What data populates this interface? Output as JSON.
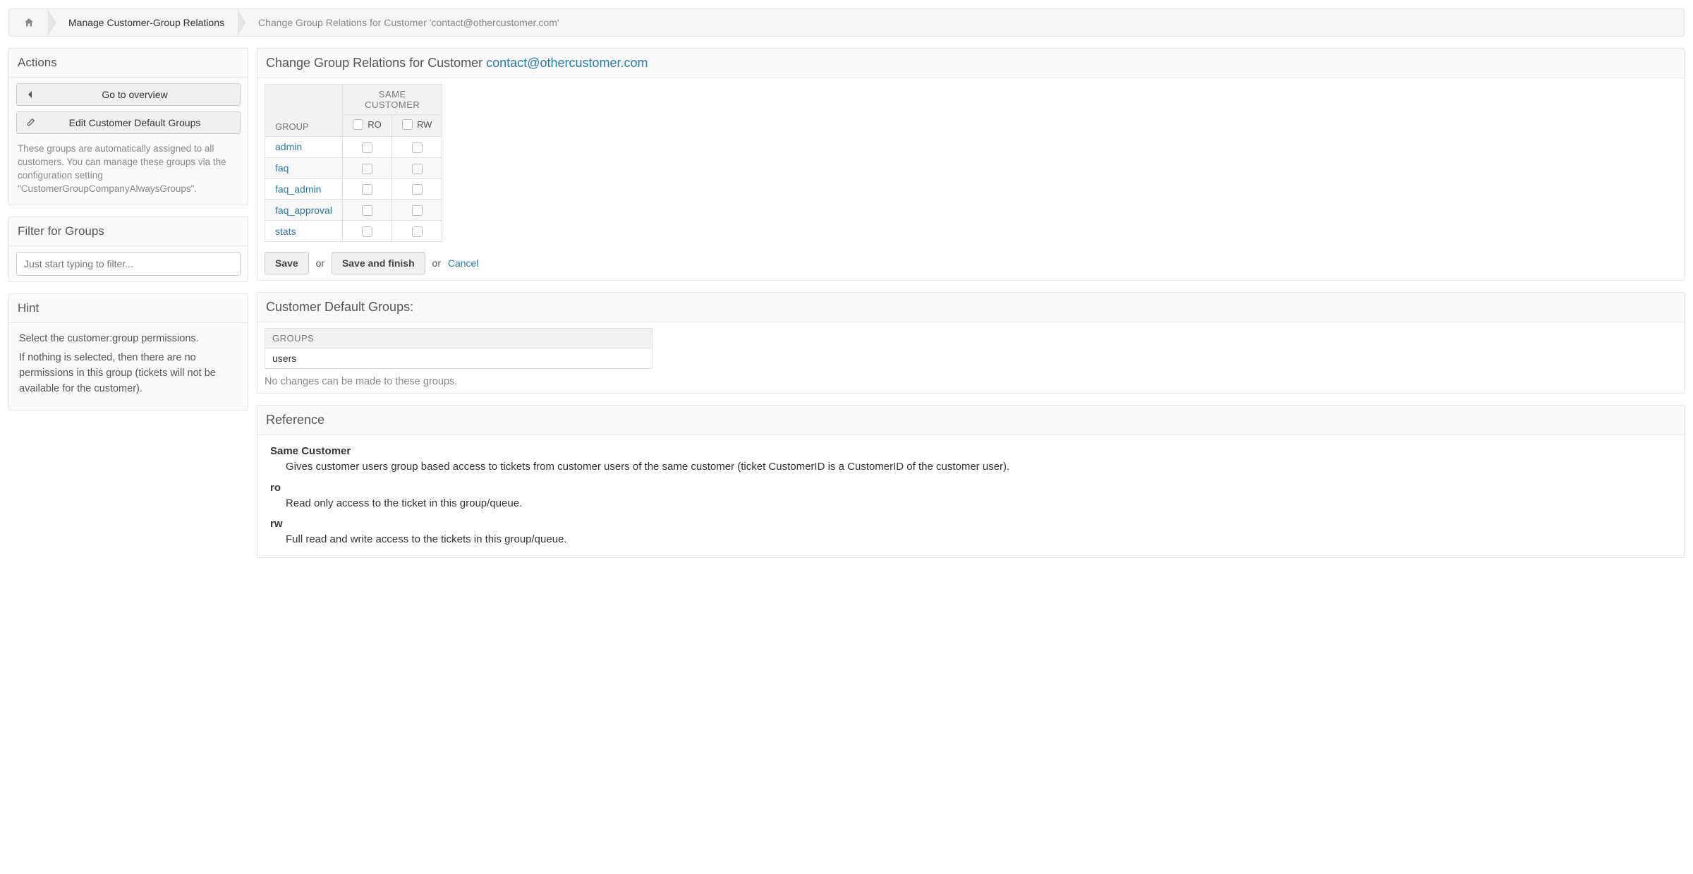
{
  "breadcrumb": {
    "manage": "Manage Customer-Group Relations",
    "current": "Change Group Relations for Customer 'contact@othercustomer.com'"
  },
  "sidebar": {
    "actions": {
      "title": "Actions",
      "overview_label": "Go to overview",
      "edit_defaults_label": "Edit Customer Default Groups",
      "note": "These groups are automatically assigned to all customers. You can manage these groups via the configuration setting \"CustomerGroupCompanyAlwaysGroups\"."
    },
    "filter": {
      "title": "Filter for Groups",
      "placeholder": "Just start typing to filter..."
    },
    "hint": {
      "title": "Hint",
      "p1": "Select the customer:group permissions.",
      "p2": "If nothing is selected, then there are no permissions in this group (tickets will not be available for the customer)."
    }
  },
  "main": {
    "title_prefix": "Change Group Relations for Customer ",
    "customer_email": "contact@othercustomer.com",
    "table": {
      "group_col": "GROUP",
      "same_customer": "SAME CUSTOMER",
      "ro": "RO",
      "rw": "RW",
      "rows": [
        "admin",
        "faq",
        "faq_admin",
        "faq_approval",
        "stats"
      ]
    },
    "buttons": {
      "save": "Save",
      "or1": "or",
      "save_finish": "Save and finish",
      "or2": "or",
      "cancel": "Cancel"
    },
    "defaults": {
      "title": "Customer Default Groups:",
      "col": "GROUPS",
      "row": "users",
      "note": "No changes can be made to these groups."
    },
    "reference": {
      "title": "Reference",
      "same_customer_t": "Same Customer",
      "same_customer_d": "Gives customer users group based access to tickets from customer users of the same customer (ticket CustomerID is a CustomerID of the customer user).",
      "ro_t": "ro",
      "ro_d": "Read only access to the ticket in this group/queue.",
      "rw_t": "rw",
      "rw_d": "Full read and write access to the tickets in this group/queue."
    }
  }
}
